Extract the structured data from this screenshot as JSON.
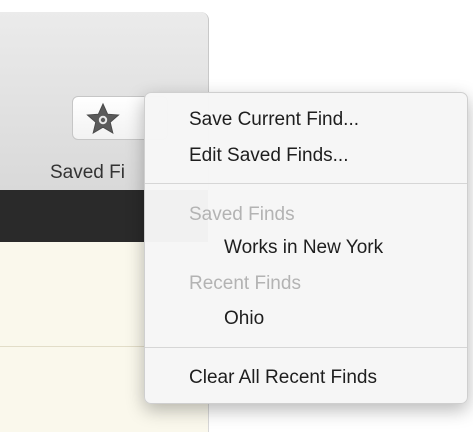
{
  "toolbar": {
    "saved_finds_label": "Saved Fi",
    "star_icon": "star-icon"
  },
  "menu": {
    "save_current_find": "Save Current Find...",
    "edit_saved_finds": "Edit Saved Finds...",
    "saved_finds_header": "Saved Finds",
    "saved_finds_items": [
      "Works in New York"
    ],
    "recent_finds_header": "Recent Finds",
    "recent_finds_items": [
      "Ohio"
    ],
    "clear_all_recent_finds": "Clear All Recent Finds"
  },
  "colors": {
    "menu_text": "#1e1e1e",
    "menu_header_text": "#b3b3b3",
    "toolbar_dark_strip": "#2a2a2a",
    "content_background": "#faf8ec"
  }
}
